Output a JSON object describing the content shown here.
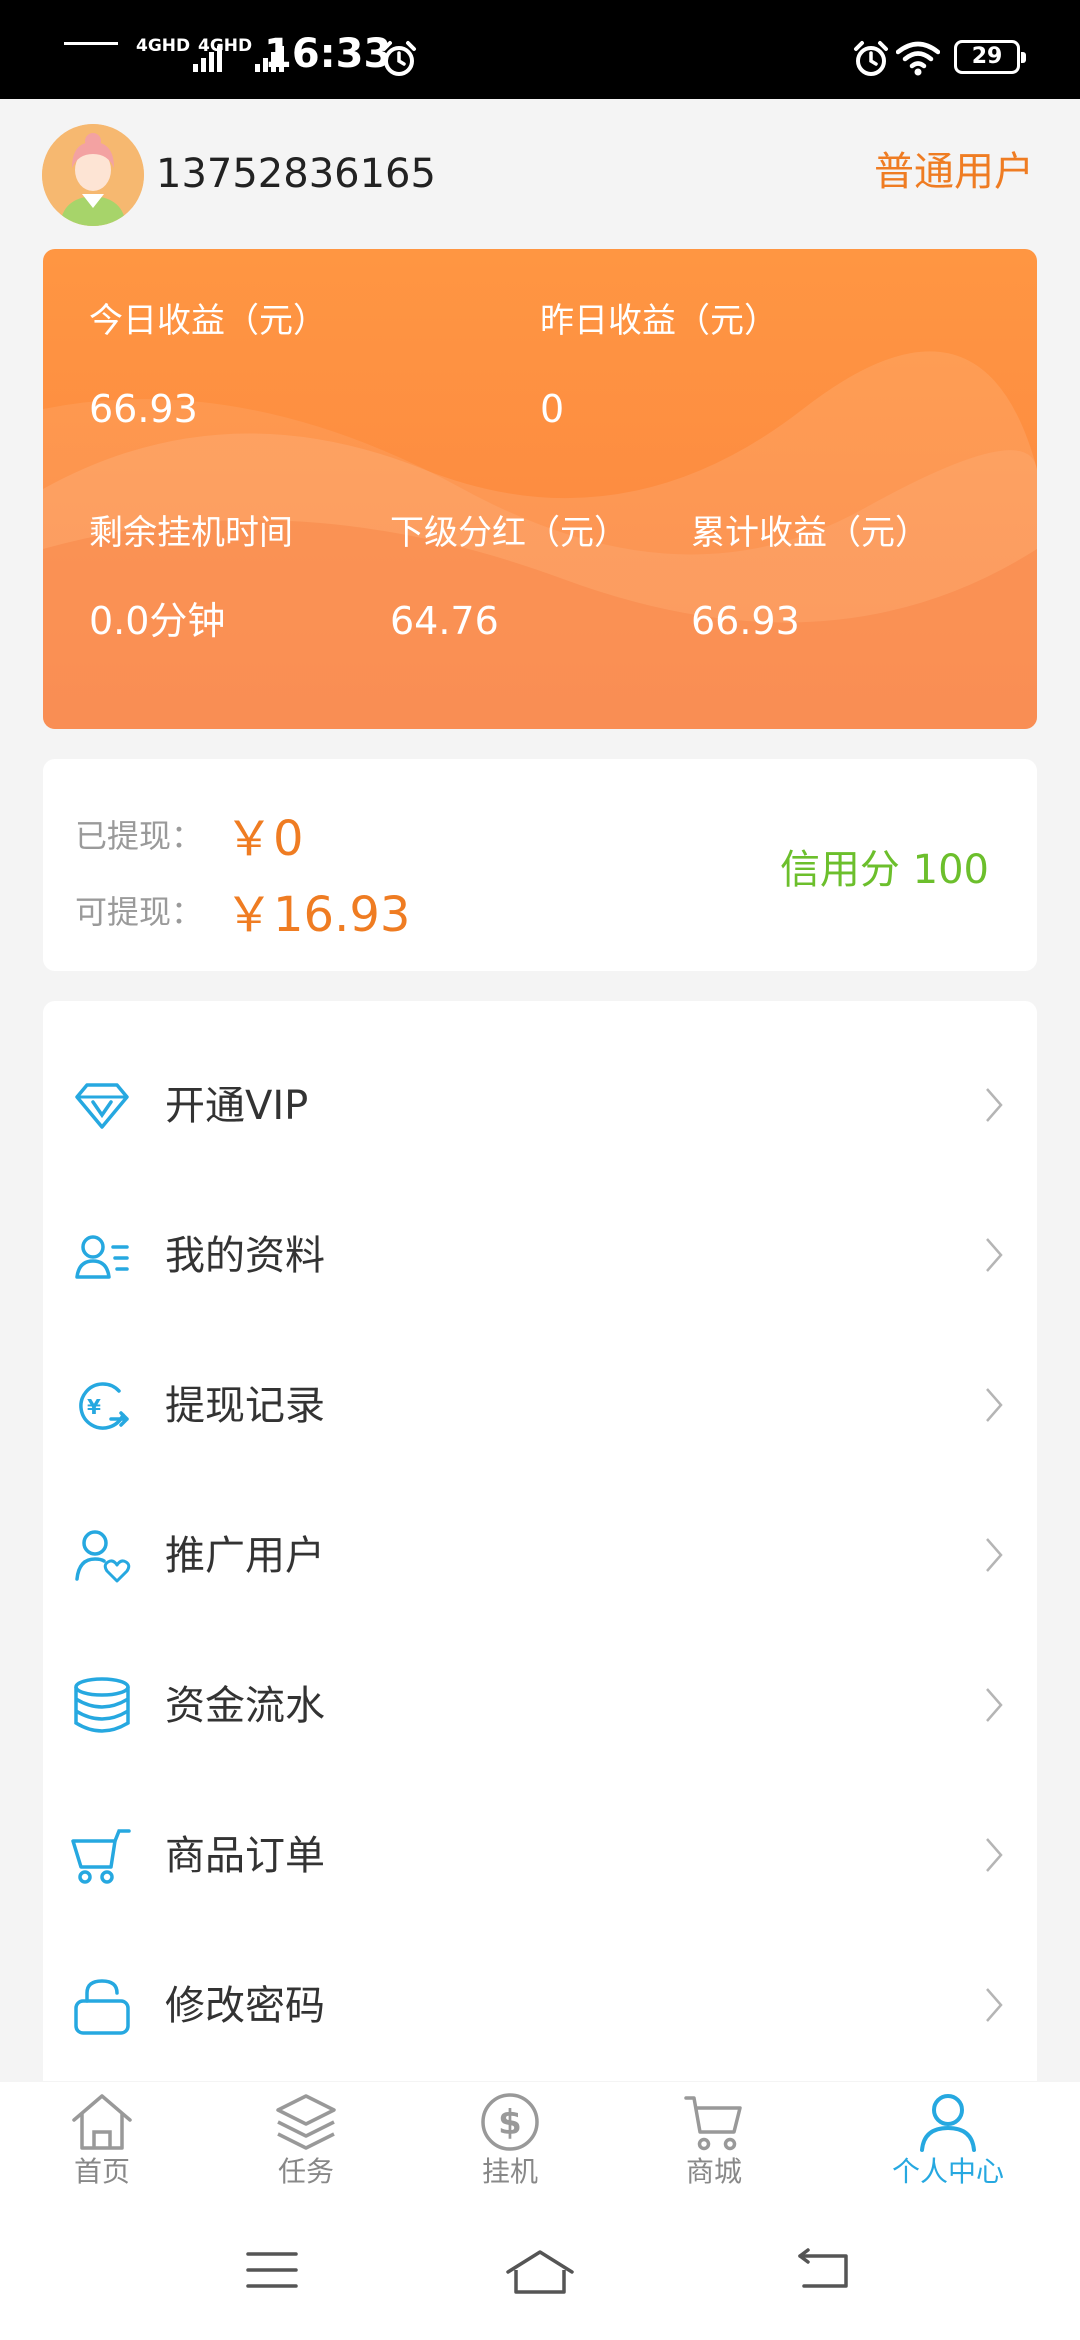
{
  "status_bar": {
    "signal1": "4GHD",
    "signal2": "4GHD",
    "time": "16:33",
    "battery": "29"
  },
  "header": {
    "phone": "13752836165",
    "user_type": "普通用户"
  },
  "earnings": {
    "today_label": "今日收益（元）",
    "today_value": "66.93",
    "yesterday_label": "昨日收益（元）",
    "yesterday_value": "0",
    "remaining_label": "剩余挂机时间",
    "remaining_value": "0.0分钟",
    "subordinate_label": "下级分红（元）",
    "subordinate_value": "64.76",
    "total_label": "累计收益（元）",
    "total_value": "66.93"
  },
  "withdraw": {
    "withdrawn_label": "已提现：",
    "withdrawn_value": "￥0",
    "available_label": "可提现：",
    "available_value": "￥16.93",
    "credit": "信用分 100"
  },
  "menu": [
    {
      "label": "开通VIP",
      "icon": "diamond-icon"
    },
    {
      "label": "我的资料",
      "icon": "profile-icon"
    },
    {
      "label": "提现记录",
      "icon": "withdraw-record-icon"
    },
    {
      "label": "推广用户",
      "icon": "promote-user-icon"
    },
    {
      "label": "资金流水",
      "icon": "coins-stack-icon"
    },
    {
      "label": "商品订单",
      "icon": "cart-icon"
    },
    {
      "label": "修改密码",
      "icon": "lock-icon"
    }
  ],
  "bottom_nav": [
    {
      "label": "首页",
      "icon": "home-icon"
    },
    {
      "label": "任务",
      "icon": "layers-icon"
    },
    {
      "label": "挂机",
      "icon": "dollar-icon"
    },
    {
      "label": "商城",
      "icon": "shop-cart-icon"
    },
    {
      "label": "个人中心",
      "icon": "person-icon",
      "active": true
    }
  ],
  "colors": {
    "accent_orange": "#ef7c22",
    "card_orange": "#fb8440",
    "credit_green": "#6cbf2c",
    "icon_blue": "#26a8e0"
  }
}
